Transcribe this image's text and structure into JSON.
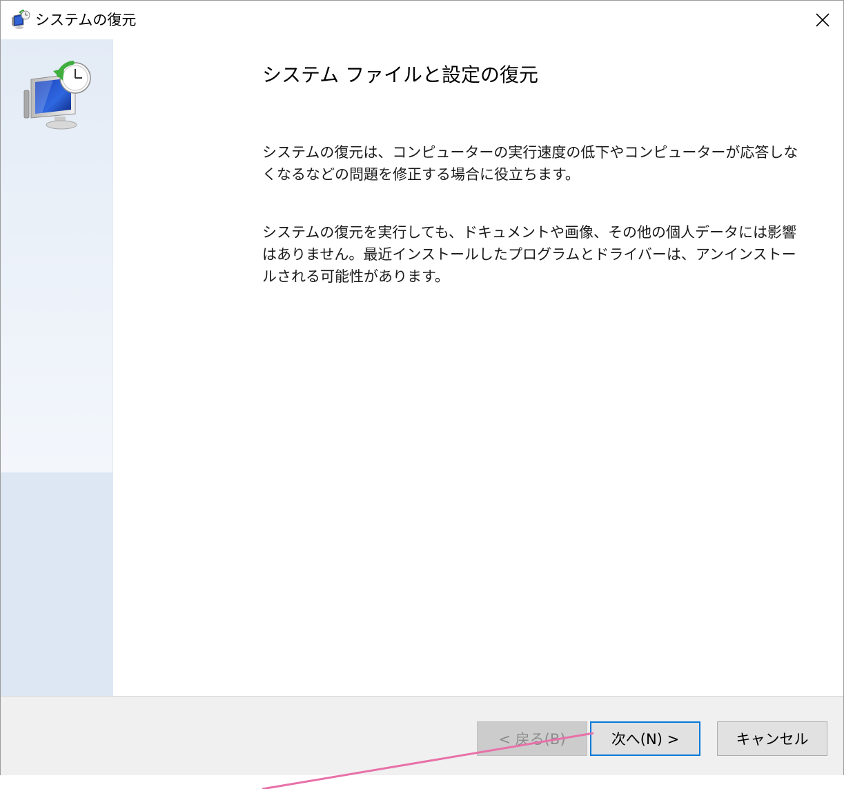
{
  "window": {
    "title": "システムの復元"
  },
  "icons": {
    "title_icon": "system-restore-icon",
    "close_icon": "close-icon",
    "hero_icon": "system-restore-monitor-clock-icon"
  },
  "content": {
    "heading": "システム ファイルと設定の復元",
    "paragraph1": "システムの復元は、コンピューターの実行速度の低下やコンピューターが応答しなくなるなどの問題を修正する場合に役立ちます。",
    "paragraph2": "システムの復元を実行しても、ドキュメントや画像、その他の個人データには影響はありません。最近インストールしたプログラムとドライバーは、アンインストールされる可能性があります。"
  },
  "footer": {
    "back_label": "< 戻る(B)",
    "next_label": "次へ(N) >",
    "cancel_label": "キャンセル"
  },
  "colors": {
    "accent": "#0078d7",
    "sidebar": "#dde7f4",
    "annotation_line": "#e870a8"
  }
}
